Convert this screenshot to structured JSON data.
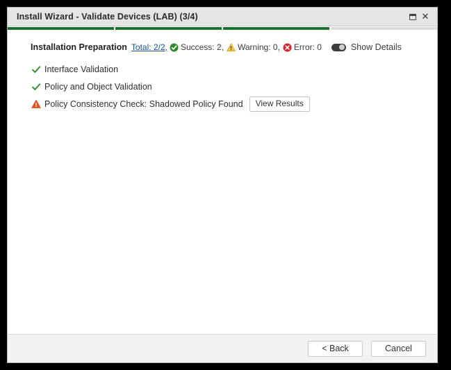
{
  "window": {
    "title": "Install Wizard - Validate Devices (LAB) (3/4)",
    "restore_icon": "restore-window-icon",
    "close_icon": "close-icon"
  },
  "progress": {
    "total_steps": 4,
    "current_step": 3,
    "completed_color": "#1c7430",
    "remaining_color": "#dcdcdc"
  },
  "summary": {
    "title": "Installation Preparation",
    "total_link": "Total: 2/2,",
    "success_label": "Success: 2,",
    "warning_label": "Warning: 0,",
    "error_label": "Error: 0",
    "show_details_label": "Show Details",
    "show_details_on": false,
    "colors": {
      "link": "#1a4f8f",
      "success": "#2e8b2e",
      "warning": "#f0b323",
      "error": "#d9232e"
    }
  },
  "checklist": [
    {
      "status": "success",
      "icon": "check-icon",
      "label": "Interface Validation",
      "has_button": false,
      "button_label": ""
    },
    {
      "status": "success",
      "icon": "check-icon",
      "label": "Policy and Object Validation",
      "has_button": false,
      "button_label": ""
    },
    {
      "status": "warning",
      "icon": "warning-triangle-icon",
      "label": "Policy Consistency Check: Shadowed Policy Found",
      "has_button": true,
      "button_label": "View Results"
    }
  ],
  "footer": {
    "back_label": "< Back",
    "cancel_label": "Cancel"
  }
}
